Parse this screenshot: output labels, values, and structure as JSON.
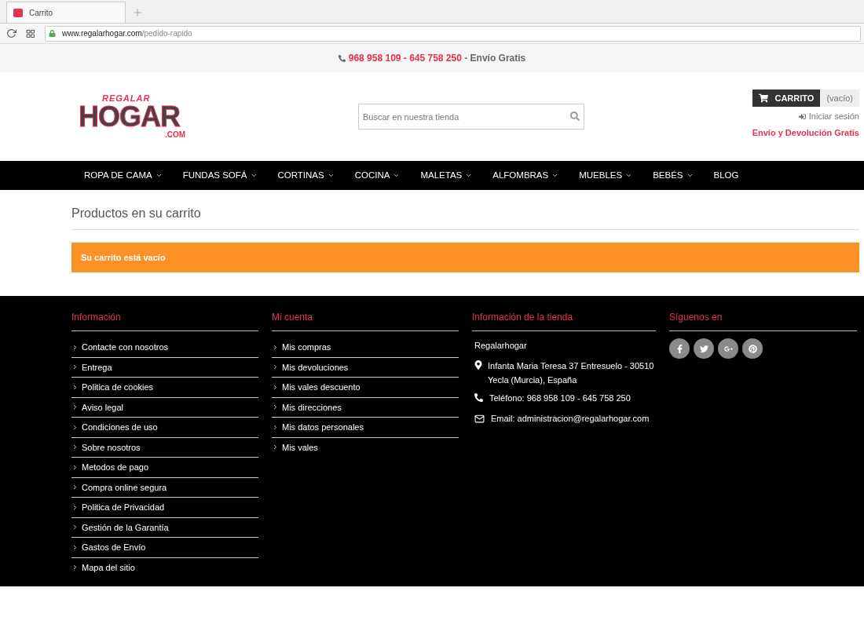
{
  "browser": {
    "tab_title": "Carrito",
    "url_domain": "www.regalarhogar.com",
    "url_path": "/pedido-rapido"
  },
  "topbar": {
    "phones": "968 958 109 - 645 758 250",
    "suffix": " - Envío Gratis"
  },
  "logo": {
    "top": "REGALAR",
    "main": "HOGAR",
    "bottom": ".COM"
  },
  "search": {
    "placeholder": "Buscar en nuestra tienda"
  },
  "cart": {
    "label": "CARRITO",
    "status": "(vacío)"
  },
  "login": "Iniciar sesión",
  "promo": "Envío y Devolución Gratis",
  "nav": [
    {
      "label": "ROPA DE CAMA",
      "dropdown": true
    },
    {
      "label": "FUNDAS SOFÁ",
      "dropdown": true
    },
    {
      "label": "CORTINAS",
      "dropdown": true
    },
    {
      "label": "COCINA",
      "dropdown": true
    },
    {
      "label": "MALETAS",
      "dropdown": true
    },
    {
      "label": "ALFOMBRAS",
      "dropdown": true
    },
    {
      "label": "MUEBLES",
      "dropdown": true
    },
    {
      "label": "BEBÉS",
      "dropdown": true
    },
    {
      "label": "BLOG",
      "dropdown": false
    }
  ],
  "page_title": "Productos en su carrito",
  "alert": "Su carrito está vacío",
  "footer": {
    "info": {
      "title": "Información",
      "links": [
        "Contacte con nosotros",
        "Entrega",
        "Politica de cookies",
        "Aviso legal",
        "Condiciones de uso",
        "Sobre nosotros",
        "Metodos de pago",
        "Compra online segura",
        "Politica de Privacidad",
        "Gestión de la Garantía",
        "Gastos de Envío",
        "Mapa del sitio"
      ]
    },
    "account": {
      "title": "Mi cuenta",
      "links": [
        "Mis compras",
        "Mis devoluciones",
        "Mis vales descuento",
        "Mis direcciones",
        "Mis datos personales",
        "Mis vales"
      ]
    },
    "store": {
      "title": "Información de la tienda",
      "name": "Regalarhogar",
      "address": "Infanta Maria Teresa 37 Entresuelo - 30510 Yecla (Murcia), España",
      "phone": "Teléfono: 968 958 109 - 645 758 250",
      "email": "Email: administracion@regalarhogar.com"
    },
    "social": {
      "title": "Síguenos en",
      "networks": [
        {
          "kind": "facebook"
        },
        {
          "kind": "twitter"
        },
        {
          "kind": "googleplus"
        },
        {
          "kind": "pinterest"
        }
      ]
    }
  }
}
